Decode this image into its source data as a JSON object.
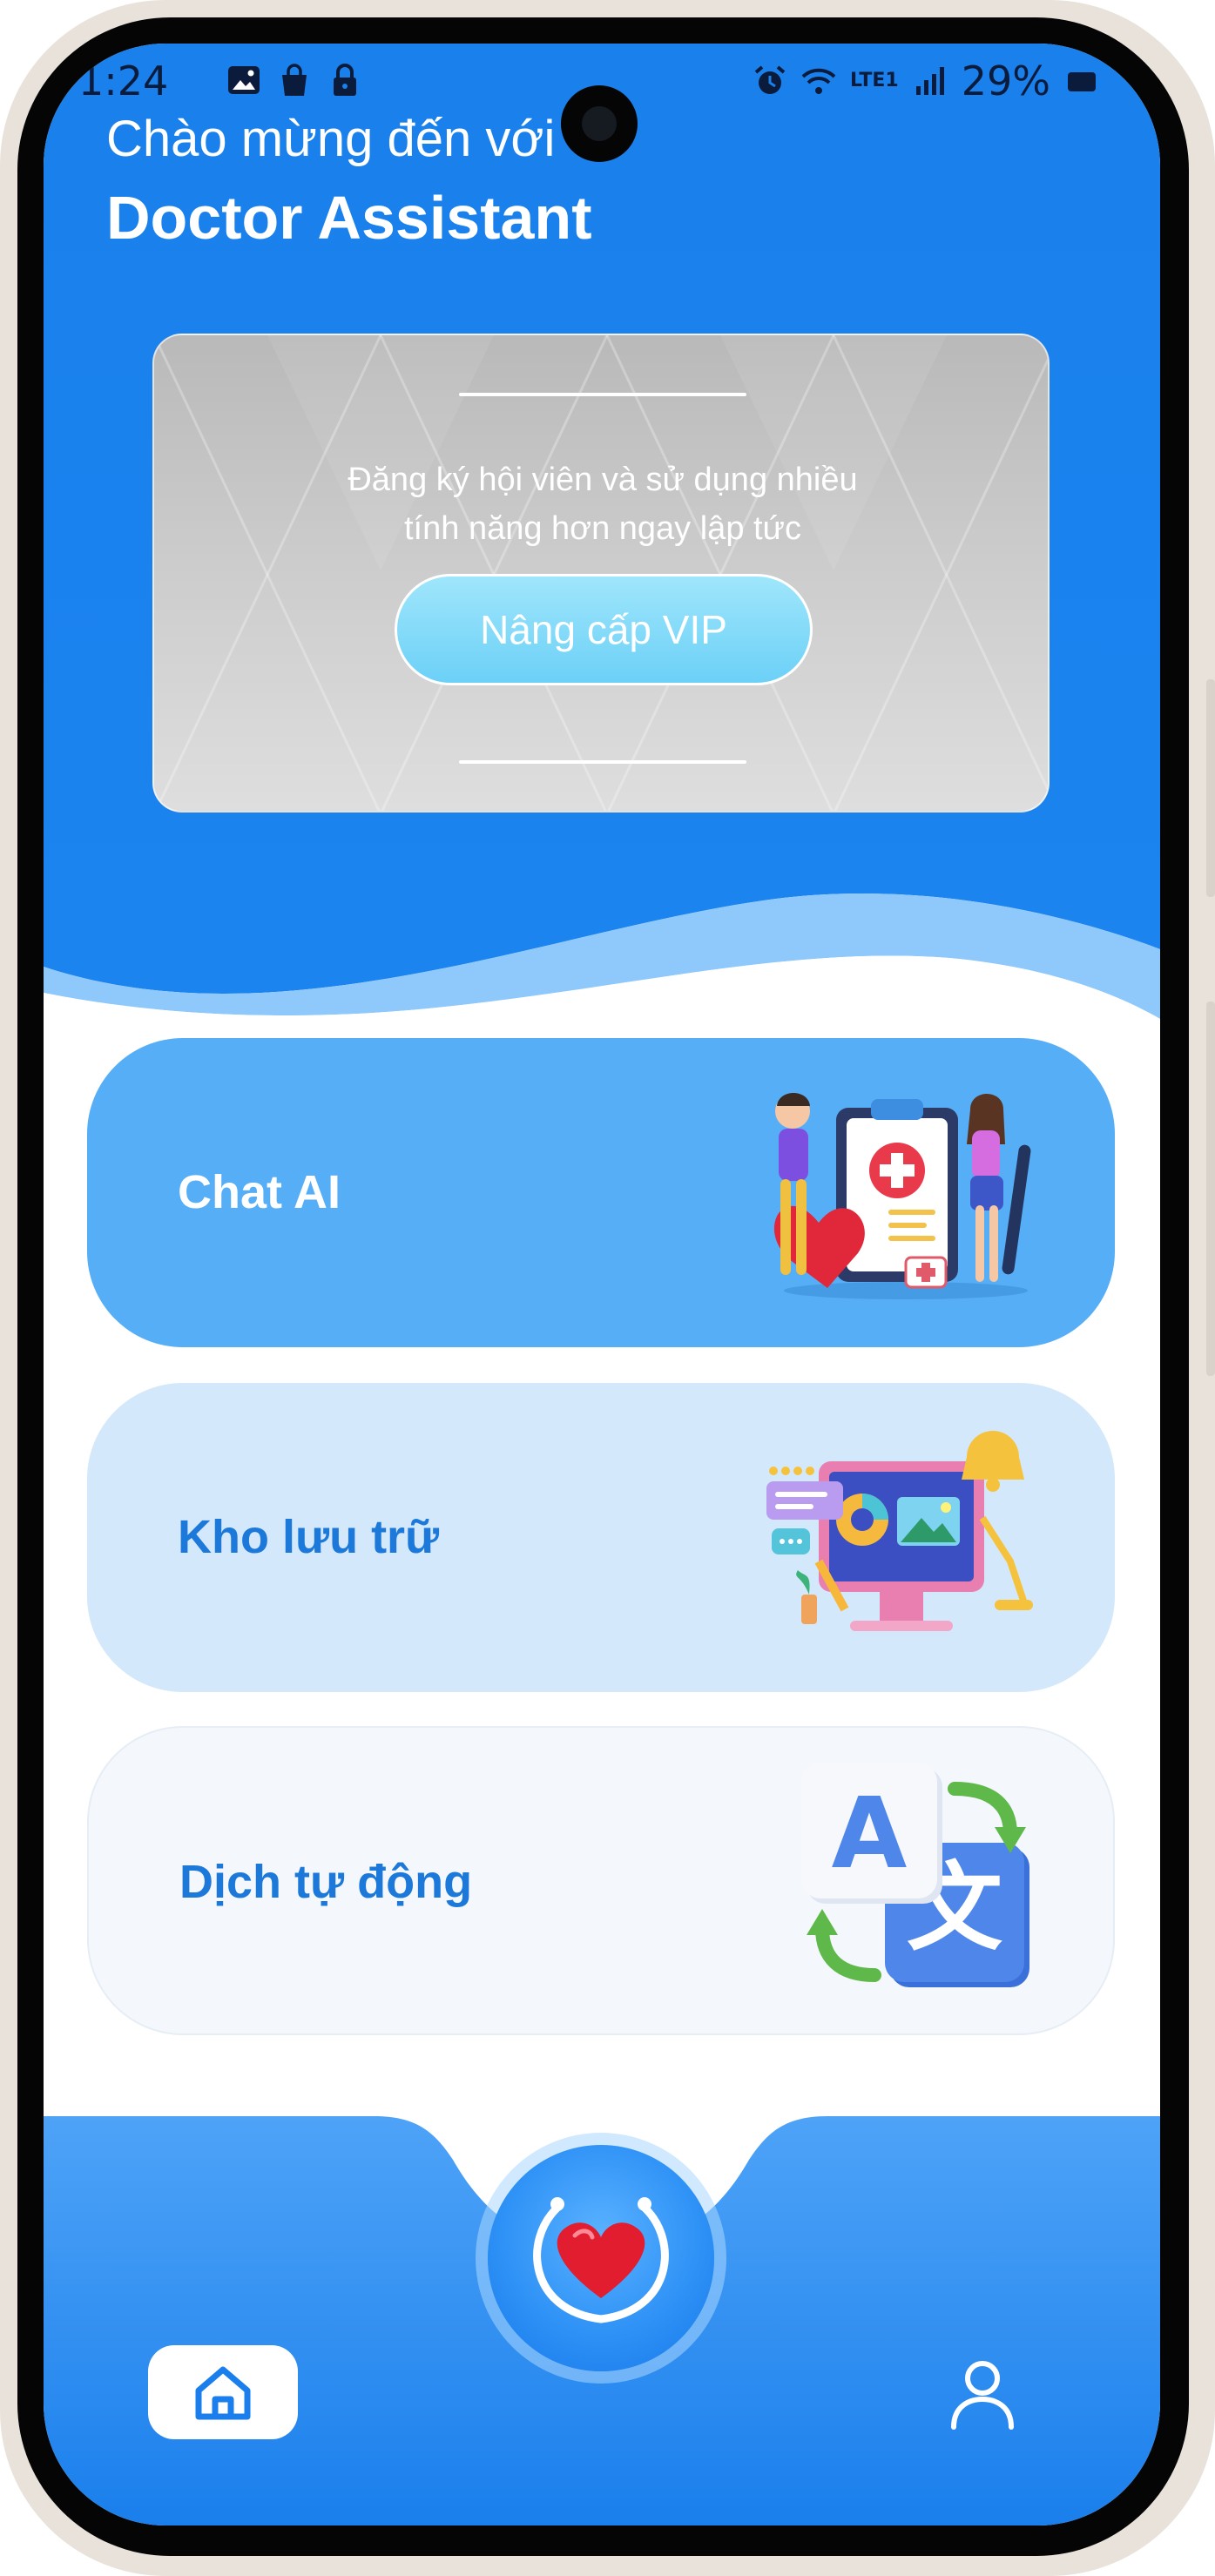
{
  "status_bar": {
    "time": "1:24",
    "battery": "29%",
    "network": "LTE1",
    "left_icons": [
      "image-icon",
      "shopping-bag-icon",
      "lock-icon"
    ],
    "right_icons": [
      "alarm-icon",
      "wifi-icon",
      "volte-icon",
      "signal-icon",
      "battery-icon"
    ]
  },
  "header": {
    "greeting": "Chào mừng đến với",
    "title": "Doctor Assistant"
  },
  "vip_card": {
    "text_line1": "Đăng ký hội viên và sử dụng nhiều",
    "text_line2": "tính năng hơn ngay lập tức",
    "button_label": "Nâng cấp VIP"
  },
  "features": [
    {
      "label": "Chat AI",
      "icon": "medical-illustration-icon"
    },
    {
      "label": "Kho lưu trữ",
      "icon": "computer-media-illustration-icon"
    },
    {
      "label": "Dịch tự động",
      "icon": "translate-icon"
    }
  ],
  "bottom_nav": {
    "left": "home-icon",
    "center": "heart-stethoscope-icon",
    "right": "profile-icon"
  },
  "colors": {
    "primary_blue": "#1a80ec",
    "card_chat": "#56aef6",
    "card_storage": "#d4e8fb",
    "card_translate": "#f4f8fd",
    "accent_text": "#1c79da"
  }
}
